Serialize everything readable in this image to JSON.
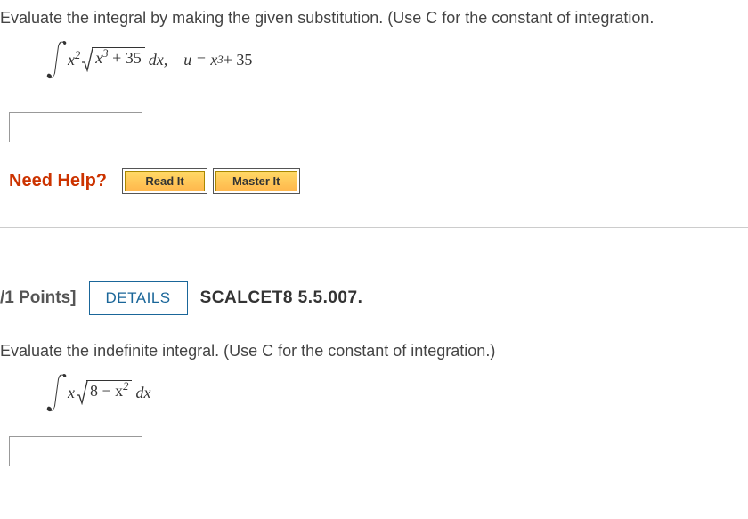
{
  "q1": {
    "prompt": "Evaluate the integral by making the given substitution. (Use C for the constant of integration.",
    "integral": {
      "integrand_prefix": "x",
      "integrand_prefix_sup": "2",
      "sqrt_inner_base": "x",
      "sqrt_inner_sup": "3",
      "sqrt_inner_tail": " + 35",
      "trail": " dx,",
      "sub_lhs": "u = x",
      "sub_sup": "3",
      "sub_tail": " + 35"
    }
  },
  "help": {
    "label": "Need Help?",
    "read": "Read It",
    "master": "Master It"
  },
  "points": {
    "label": "/1 Points]",
    "details": "DETAILS",
    "ref": "SCALCET8 5.5.007."
  },
  "q2": {
    "prompt": "Evaluate the indefinite integral. (Use C for the constant of integration.)",
    "integral": {
      "prefix": "x",
      "sqrt_inner_lead": "8 − x",
      "sqrt_inner_sup": "2",
      "trail": " dx"
    }
  }
}
